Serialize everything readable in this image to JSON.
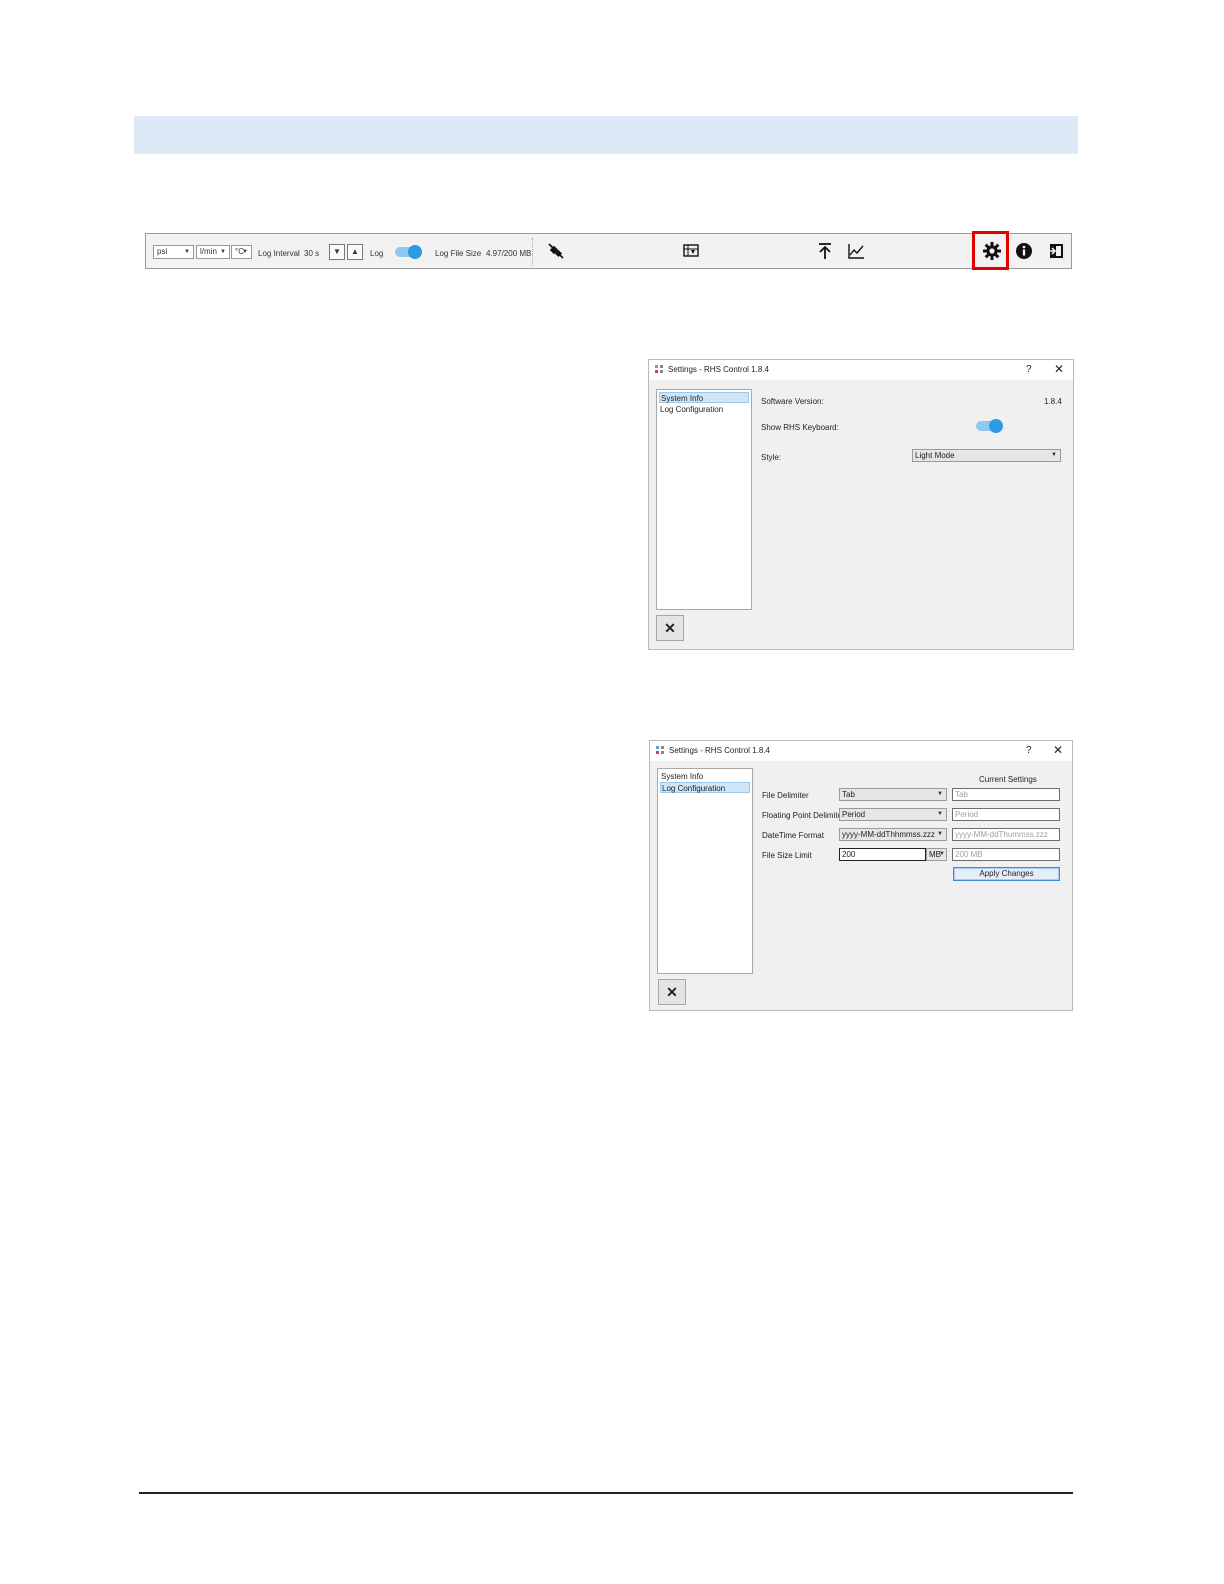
{
  "toolbar": {
    "pressure_unit": "psi",
    "flow_unit": "l/min",
    "temp_unit": "°C",
    "log_interval_label": "Log Interval",
    "log_interval_value": "30 s",
    "log_label": "Log",
    "log_enabled": true,
    "log_file_size_label": "Log File Size",
    "log_file_size_value": "4.97/200 MB",
    "icons": [
      "disconnect-icon",
      "data-table-icon",
      "upload-icon",
      "chart-icon",
      "settings-icon",
      "info-icon",
      "exit-icon"
    ]
  },
  "dialog1": {
    "title": "Settings - RHS Control 1.8.4",
    "help": "?",
    "close": "✕",
    "nav": [
      "System Info",
      "Log Configuration"
    ],
    "selected_nav": 0,
    "software_version_label": "Software Version:",
    "software_version_value": "1.8.4",
    "show_keyboard_label": "Show RHS Keyboard:",
    "show_keyboard_enabled": true,
    "style_label": "Style:",
    "style_value": "Light Mode",
    "close_button": "✕"
  },
  "dialog2": {
    "title": "Settings - RHS Control 1.8.4",
    "help": "?",
    "close": "✕",
    "nav": [
      "System Info",
      "Log Configuration"
    ],
    "selected_nav": 1,
    "current_settings_header": "Current Settings",
    "rows": [
      {
        "label": "File Delimiter",
        "value": "Tab",
        "current": "Tab"
      },
      {
        "label": "Floating Point Delimiter",
        "value": "Period",
        "current": "Period"
      },
      {
        "label": "DateTime Format",
        "value": "yyyy-MM-ddThhmmss.zzz",
        "current": "yyyy-MM-ddThummss.zzz"
      },
      {
        "label": "File Size Limit",
        "value": "200",
        "unit": "MB",
        "current": "200 MB"
      }
    ],
    "apply_button": "Apply Changes",
    "close_button": "✕"
  },
  "colors": {
    "header_band": "#dde9f6",
    "highlight": "#e00000",
    "toggle_on": "#2d9be4",
    "selection": "#cfe6f8"
  }
}
